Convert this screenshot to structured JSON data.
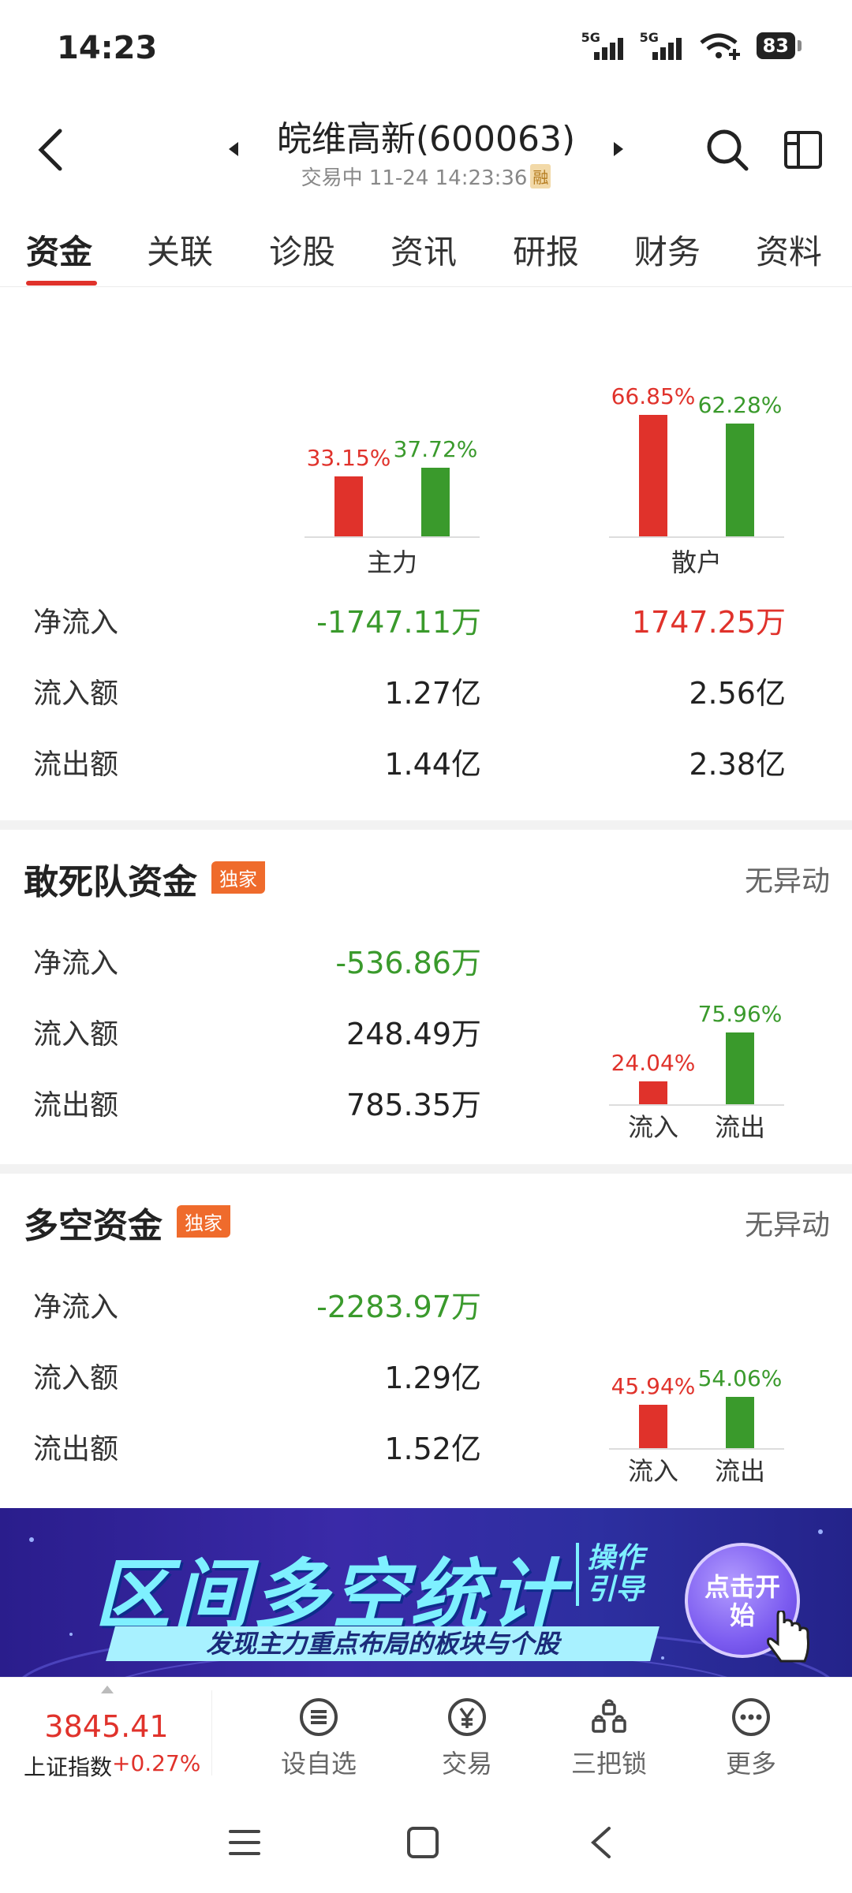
{
  "status_bar": {
    "time": "14:23",
    "net1": "5G",
    "net2": "5G",
    "battery": "83"
  },
  "header": {
    "title": "皖维高新(600063)",
    "subtitle": "交易中 11-24 14:23:36",
    "rong_badge": "融"
  },
  "tabs": [
    "资金",
    "关联",
    "诊股",
    "资讯",
    "研报",
    "财务",
    "资料"
  ],
  "main_fund": {
    "charts": [
      {
        "label": "主力",
        "in_pct_text": "33.15%",
        "out_pct_text": "37.72%",
        "in_pct": 33.15,
        "out_pct": 37.72
      },
      {
        "label": "散户",
        "in_pct_text": "66.85%",
        "out_pct_text": "62.28%",
        "in_pct": 66.85,
        "out_pct": 62.28
      }
    ],
    "rows": [
      {
        "label": "净流入",
        "main": "-1747.11万",
        "retail": "1747.25万"
      },
      {
        "label": "流入额",
        "main": "1.27亿",
        "retail": "2.56亿"
      },
      {
        "label": "流出额",
        "main": "1.44亿",
        "retail": "2.38亿"
      }
    ],
    "colors": {
      "in": "#e0322b",
      "out": "#3a9a2c"
    }
  },
  "dare_fund": {
    "title": "敢死队资金",
    "badge": "独家",
    "status": "无异动",
    "rows": [
      {
        "label": "净流入",
        "value": "-536.86万"
      },
      {
        "label": "流入额",
        "value": "248.49万"
      },
      {
        "label": "流出额",
        "value": "785.35万"
      }
    ],
    "chart": {
      "in_pct_text": "24.04%",
      "out_pct_text": "75.96%",
      "in_pct": 24.04,
      "out_pct": 75.96,
      "in_label": "流入",
      "out_label": "流出"
    }
  },
  "longshort_fund": {
    "title": "多空资金",
    "badge": "独家",
    "status": "无异动",
    "rows": [
      {
        "label": "净流入",
        "value": "-2283.97万"
      },
      {
        "label": "流入额",
        "value": "1.29亿"
      },
      {
        "label": "流出额",
        "value": "1.52亿"
      }
    ],
    "chart": {
      "in_pct_text": "45.94%",
      "out_pct_text": "54.06%",
      "in_pct": 45.94,
      "out_pct": 54.06,
      "in_label": "流入",
      "out_label": "流出"
    }
  },
  "banner": {
    "main": "区间多空统计",
    "guide_line1": "操作",
    "guide_line2": "引导",
    "sub": "发现主力重点布局的板块与个股",
    "button": "点击开始"
  },
  "bottom_bar": {
    "index_value": "3845.41",
    "index_name": "上证指数",
    "index_change": "+0.27%",
    "items": [
      {
        "label": "设自选",
        "icon": "list-circle-icon"
      },
      {
        "label": "交易",
        "icon": "yen-circle-icon"
      },
      {
        "label": "三把锁",
        "icon": "locks-icon"
      },
      {
        "label": "更多",
        "icon": "more-dots-icon"
      }
    ]
  }
}
